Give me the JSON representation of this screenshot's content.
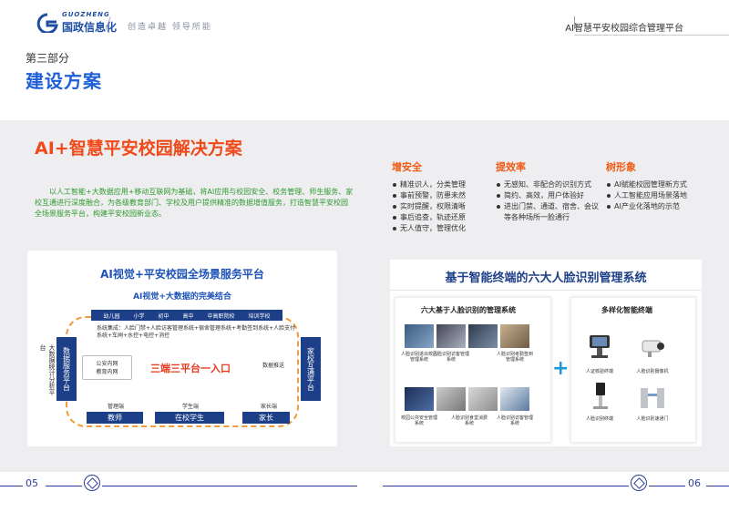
{
  "header": {
    "logo_text_en": "GUOZHENG",
    "logo_text_cn": "国政信息化",
    "slogan": "创造卓越 领导所能",
    "platform": "AI智慧平安校园综合管理平台"
  },
  "section": {
    "part": "第三部分",
    "title": "建设方案"
  },
  "solution": {
    "title": "AI+智慧平安校园解决方案",
    "intro": "以人工智能+大数据应用+移动互联网为基础，将AI应用与校园安全、校务管理、师生服务、家校互通进行深度融合，为各级教育部门、学校及用户提供精准的数据增值服务，打造智慧平安校园全场景服务平台，构建平安校园新业态。"
  },
  "columns": [
    {
      "title": "增安全",
      "items": [
        "精准识人，分类管理",
        "事前预警，防患未然",
        "实时提醒，权限清晰",
        "事后追查，轨迹还原",
        "无人值守，管理优化"
      ]
    },
    {
      "title": "提效率",
      "items": [
        "无感知、非配合的识别方式",
        "简约、高效，用户体验好",
        "进出门禁、通道、宿舍、会议等各种场所一脸通行"
      ]
    },
    {
      "title": "树形象",
      "items": [
        "AI赋能校园管理新方式",
        "人工智能应用场景落地",
        "AI产业化落地的示范"
      ]
    }
  ],
  "left_card": {
    "title": "AI视觉+平安校园全场景服务平台",
    "subtitle": "AI视觉+大数据的完美结合",
    "levels": [
      "幼儿园",
      "小学",
      "初中",
      "高中",
      "中高职院校",
      "培训学校"
    ],
    "systems": "系统集成：人脸门禁+人脸访客管理系统+宿舍管理系统+考勤签到系统+人脸支付系统+车闸+水控+电控+消控",
    "left_box": "数据服务平台",
    "left_label": "大数据统计分析平台",
    "right_box": "家校互通平台",
    "police": "公安内网\n教育内网",
    "data_push": "数据推送",
    "center": "三端三平台一入口",
    "labels": {
      "admin": "管理端",
      "student": "学生端",
      "parent": "家长端"
    },
    "bottom": {
      "teacher": "教师",
      "student": "在校学生",
      "parent": "家长"
    }
  },
  "right_card": {
    "title": "基于智能终端的六大人脸识别管理系统",
    "left_title": "六大基于人脸识别的管理系统",
    "systems": [
      "人脸识别进出校园管理系统",
      "人脸识别访客管理系统",
      "人脸识别考勤签到管理系统",
      "校园公共安全管理系统",
      "人脸识别食堂消费系统",
      "人脸识别访客管理系统"
    ],
    "right_title": "多样化智能终端",
    "devices": [
      "人证核验终端",
      "人脸识别摄像机",
      "人脸识别终端",
      "人脸识别速通门"
    ]
  },
  "footer": {
    "page_left": "05",
    "page_right": "06"
  },
  "colors": {
    "accent_blue": "#1e5fd8",
    "orange": "#f04a1a",
    "navy": "#1d3f88",
    "green": "#2f9a2f"
  }
}
